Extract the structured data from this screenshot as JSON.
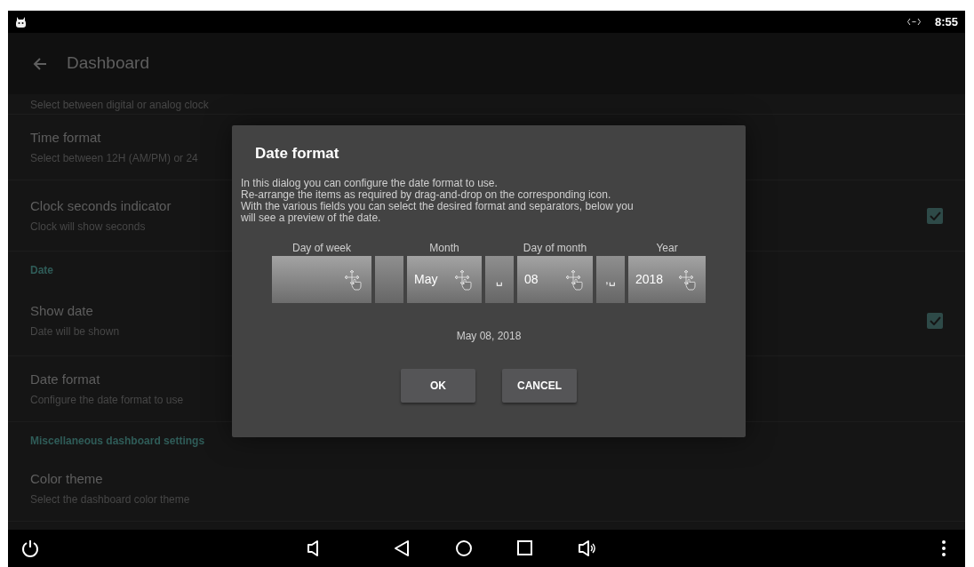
{
  "status_bar": {
    "time": "8:55"
  },
  "app_bar": {
    "title": "Dashboard"
  },
  "settings": [
    {
      "kind": "subtitle_only",
      "subtitle": "Select between digital or analog clock"
    },
    {
      "kind": "item",
      "title": "Time format",
      "subtitle": "Select between 12H (AM/PM) or 24"
    },
    {
      "kind": "check",
      "title": "Clock seconds indicator",
      "subtitle": "Clock will show seconds",
      "checked": true
    },
    {
      "kind": "header",
      "title": "Date"
    },
    {
      "kind": "check",
      "title": "Show date",
      "subtitle": "Date will be shown",
      "checked": true
    },
    {
      "kind": "item",
      "title": "Date format",
      "subtitle": "Configure the date format to use"
    },
    {
      "kind": "header",
      "title": "Miscellaneous dashboard settings"
    },
    {
      "kind": "item",
      "title": "Color theme",
      "subtitle": "Select the dashboard color theme"
    }
  ],
  "dialog": {
    "title": "Date format",
    "description": [
      "In this dialog you can configure the date format to use.",
      "Re-arrange the items as required by drag-and-drop on the corresponding icon.",
      "With the various fields you can select the desired format and separators, below you",
      "will see a preview of the date."
    ],
    "parts": [
      {
        "kind": "field",
        "label": "Day of week"
      },
      {
        "kind": "separator"
      },
      {
        "kind": "field",
        "label": "Month",
        "value": "May"
      },
      {
        "kind": "separator",
        "value": "␣"
      },
      {
        "kind": "field",
        "label": "Day of month",
        "value": "08"
      },
      {
        "kind": "separator",
        "value": ",␣"
      },
      {
        "kind": "field",
        "label": "Year",
        "value": "2018"
      }
    ],
    "preview": "May 08, 2018",
    "buttons": [
      "OK",
      "CANCEL"
    ]
  }
}
